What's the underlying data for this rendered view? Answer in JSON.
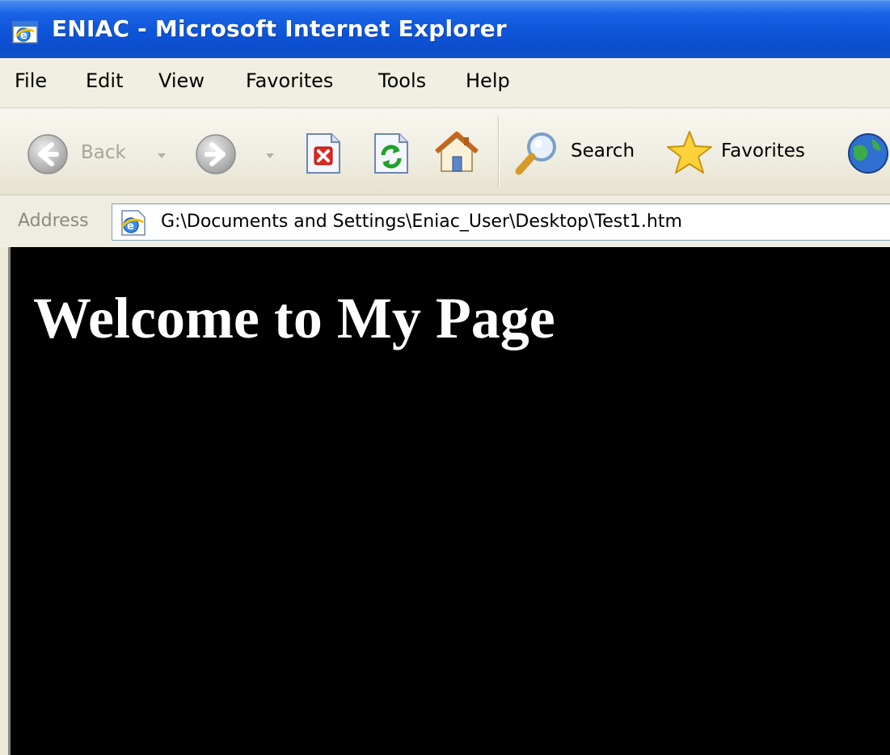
{
  "window": {
    "title": "ENIAC - Microsoft Internet Explorer"
  },
  "menubar": {
    "items": [
      {
        "label": "File"
      },
      {
        "label": "Edit"
      },
      {
        "label": "View"
      },
      {
        "label": "Favorites"
      },
      {
        "label": "Tools"
      },
      {
        "label": "Help"
      }
    ]
  },
  "toolbar": {
    "back": {
      "label": "Back",
      "icon": "back-arrow-icon",
      "enabled": false
    },
    "forward": {
      "icon": "forward-arrow-icon",
      "enabled": false
    },
    "stop": {
      "icon": "stop-icon"
    },
    "refresh": {
      "icon": "refresh-icon"
    },
    "home": {
      "icon": "home-icon"
    },
    "search": {
      "label": "Search",
      "icon": "search-icon"
    },
    "favorites": {
      "label": "Favorites",
      "icon": "star-icon"
    },
    "media": {
      "icon": "globe-icon"
    }
  },
  "address": {
    "label": "Address",
    "value": "G:\\Documents and Settings\\Eniac_User\\Desktop\\Test1.htm",
    "icon": "ie-page-icon"
  },
  "page": {
    "heading": "Welcome to My Page",
    "background": "#000000",
    "text_color": "#ffffff"
  },
  "colors": {
    "titlebar": "#0b4dcc",
    "chrome": "#ece9d8"
  }
}
